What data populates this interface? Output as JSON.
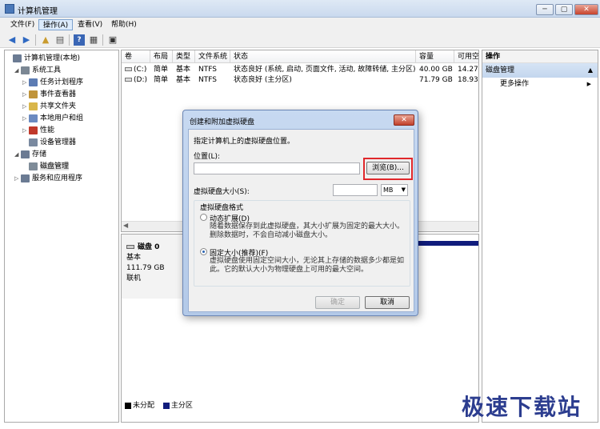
{
  "window": {
    "title": "计算机管理",
    "minimize": "─",
    "maximize": "▢",
    "close": "✕"
  },
  "menu": [
    "文件(F)",
    "操作(A)",
    "查看(V)",
    "帮助(H)"
  ],
  "toolbar": {
    "back": "◀",
    "forward": "▶",
    "up": "▲",
    "show_hide": "▤",
    "help": "?",
    "properties": "▦"
  },
  "tree": [
    {
      "label": "计算机管理(本地)",
      "icon_color": "#6b7b93",
      "expander": "",
      "indent": 0
    },
    {
      "label": "系统工具",
      "icon_color": "#7b8794",
      "expander": "◢",
      "indent": 1
    },
    {
      "label": "任务计划程序",
      "icon_color": "#5c7cb3",
      "expander": "▷",
      "indent": 2
    },
    {
      "label": "事件查看器",
      "icon_color": "#c0943a",
      "expander": "▷",
      "indent": 2
    },
    {
      "label": "共享文件夹",
      "icon_color": "#d9b64a",
      "expander": "▷",
      "indent": 2
    },
    {
      "label": "本地用户和组",
      "icon_color": "#6b8ac0",
      "expander": "▷",
      "indent": 2
    },
    {
      "label": "性能",
      "icon_color": "#c0392b",
      "expander": "▷",
      "indent": 2
    },
    {
      "label": "设备管理器",
      "icon_color": "#7a8aa0",
      "expander": "",
      "indent": 2
    },
    {
      "label": "存储",
      "icon_color": "#6b7b93",
      "expander": "◢",
      "indent": 1
    },
    {
      "label": "磁盘管理",
      "icon_color": "#7f8c99",
      "expander": "",
      "indent": 2,
      "selected": true
    },
    {
      "label": "服务和应用程序",
      "icon_color": "#6b7b93",
      "expander": "▷",
      "indent": 1
    }
  ],
  "volume_list": {
    "columns": [
      "卷",
      "布局",
      "类型",
      "文件系统",
      "状态",
      "容量",
      "可用空"
    ],
    "rows": [
      [
        "(C:)",
        "简单",
        "基本",
        "NTFS",
        "状态良好 (系统, 启动, 页面文件, 活动, 故障转储, 主分区)",
        "40.00 GB",
        "14.27"
      ],
      [
        "(D:)",
        "简单",
        "基本",
        "NTFS",
        "状态良好 (主分区)",
        "71.79 GB",
        "18.93"
      ]
    ]
  },
  "disk": {
    "name": "磁盘 0",
    "type": "基本",
    "size": "111.79 GB",
    "status": "联机"
  },
  "legend": [
    {
      "label": "未分配",
      "color": "#000000"
    },
    {
      "label": "主分区",
      "color": "#101c7c"
    }
  ],
  "actions": {
    "header": "操作",
    "section": "磁盘管理",
    "more": "更多操作",
    "section_arrow": "▲",
    "more_arrow": "▶"
  },
  "dialog": {
    "title": "创建和附加虚拟硬盘",
    "close": "✕",
    "instruction": "指定计算机上的虚拟硬盘位置。",
    "location_label": "位置(L):",
    "location_value": "",
    "browse_button": "浏览(B)...",
    "size_label": "虚拟硬盘大小(S):",
    "size_value": "",
    "unit": "MB",
    "unit_arrow": "▼",
    "format_group": "虚拟硬盘格式",
    "dynamic_label": "动态扩展(D)",
    "dynamic_desc": "随着数据保存到此虚拟硬盘，其大小扩展为固定的最大大小。删除数据时，不会自动减小磁盘大小。",
    "fixed_label": "固定大小(推荐)(F)",
    "fixed_desc": "虚拟硬盘使用固定空间大小，无论其上存储的数据多少都是如此。它的默认大小为物理硬盘上可用的最大空间。",
    "format_selected": "fixed",
    "ok_button": "确定",
    "cancel_button": "取消"
  },
  "watermark": "极速下载站"
}
